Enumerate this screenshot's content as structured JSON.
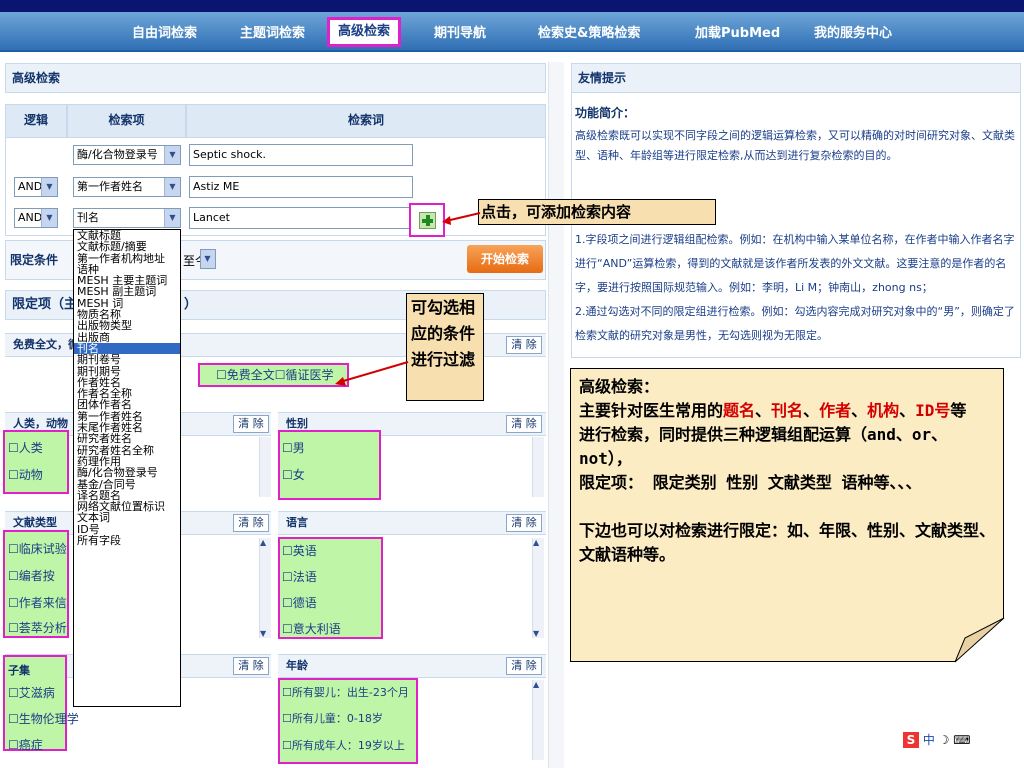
{
  "nav": {
    "items": [
      "自由词检索",
      "主题词检索",
      "高级检索",
      "期刊导航",
      "检索史&策略检索",
      "加载PubMed",
      "我的服务中心"
    ]
  },
  "left": {
    "title": "高级检索",
    "headers": {
      "logic": "逻辑",
      "field": "检索项",
      "term": "检索词"
    },
    "rows": [
      {
        "logic": "",
        "field": "酶/化合物登录号",
        "term": "Septic shock."
      },
      {
        "logic": "AND",
        "field": "第一作者姓名",
        "term": "Astiz ME"
      },
      {
        "logic": "AND",
        "field": "刊名",
        "term": "Lancet"
      }
    ],
    "limit_label": "限定条件",
    "limit_suffix": "至今",
    "start_button": "开始检索",
    "filters_title": "限定项（主",
    "filters_suffix": "）",
    "fulltext_label": "免费全文，循",
    "fulltext_options": [
      "免费全文",
      "循证医学"
    ],
    "clear_label": "清 除",
    "species": {
      "title": "人类，动物",
      "items": [
        "人类",
        "动物"
      ]
    },
    "gender": {
      "title": "性别",
      "items": [
        "男",
        "女"
      ]
    },
    "doctype": {
      "title": "文献类型",
      "items": [
        "临床试验",
        "编者按",
        "作者来信",
        "荟萃分析"
      ]
    },
    "lang": {
      "title": "语言",
      "items": [
        "英语",
        "法语",
        "德语",
        "意大利语"
      ]
    },
    "subset": {
      "title": "子集",
      "items": [
        "艾滋病",
        "生物伦理学",
        "癌症"
      ]
    },
    "age": {
      "title": "年龄",
      "items": [
        "所有婴儿：出生-23个月",
        "所有儿童：0-18岁",
        "所有成年人：19岁以上"
      ]
    }
  },
  "dropdown": {
    "options": [
      "文献标题",
      "文献标题/摘要",
      "第一作者机构地址",
      "语种",
      "MESH 主要主题词",
      "MESH 副主题词",
      "MESH 词",
      "物质名称",
      "出版物类型",
      "出版商",
      "刊名",
      "期刊卷号",
      "期刊期号",
      "作者姓名",
      "作者名全称",
      "团体作者名",
      "第一作者姓名",
      "末尾作者姓名",
      "研究者姓名",
      "研究者姓名全称",
      "药理作用",
      "酶/化合物登录号",
      "基金/合同号",
      "译名题名",
      "网络文献位置标识",
      "文本词",
      "ID号",
      "所有字段"
    ],
    "selected": "刊名"
  },
  "right": {
    "title": "友情提示",
    "func_title": "功能简介：",
    "func_text": "高级检索既可以实现不同字段之间的逻辑运算检索，又可以精确的对时间研究对象、文献类型、语种、年龄组等进行限定检索,从而达到进行复杂检索的目的。",
    "tips": "1.字段项之间进行逻辑组配检索。例如：在机构中输入某单位名称，在作者中输入作者名字进行“AND”运算检索，得到的文献就是该作者所发表的外文文献。这要注意的是作者的名字，要进行按照国际规范输入。例如：李明，Li M；钟南山，zhong ns；\n2.通过勾选对不同的限定组进行检索。例如：勾选内容完成对研究对象中的“男”，则确定了检索文献的研究对象是男性，无勾选则视为无限定。"
  },
  "callouts": {
    "add": "点击，可添加检索内容",
    "filter": "可勾选相应的条件进行过滤"
  },
  "note": {
    "l1": "高级检索：",
    "l2a": "主要针对医生常用的",
    "k1": "题名",
    "k2": "刊名",
    "k3": "作者",
    "k4": "机构",
    "k5": "ID号",
    "l2b": "等",
    "l3": "进行检索，同时提供三种逻辑组配运算（and、or、not），",
    "l4": "限定项：  限定类别 性别 文献类型 语种等、、、",
    "l5": "下边也可以对检索进行限定：如、年限、性别、文献类型、文献语种等。"
  },
  "ime": "中"
}
